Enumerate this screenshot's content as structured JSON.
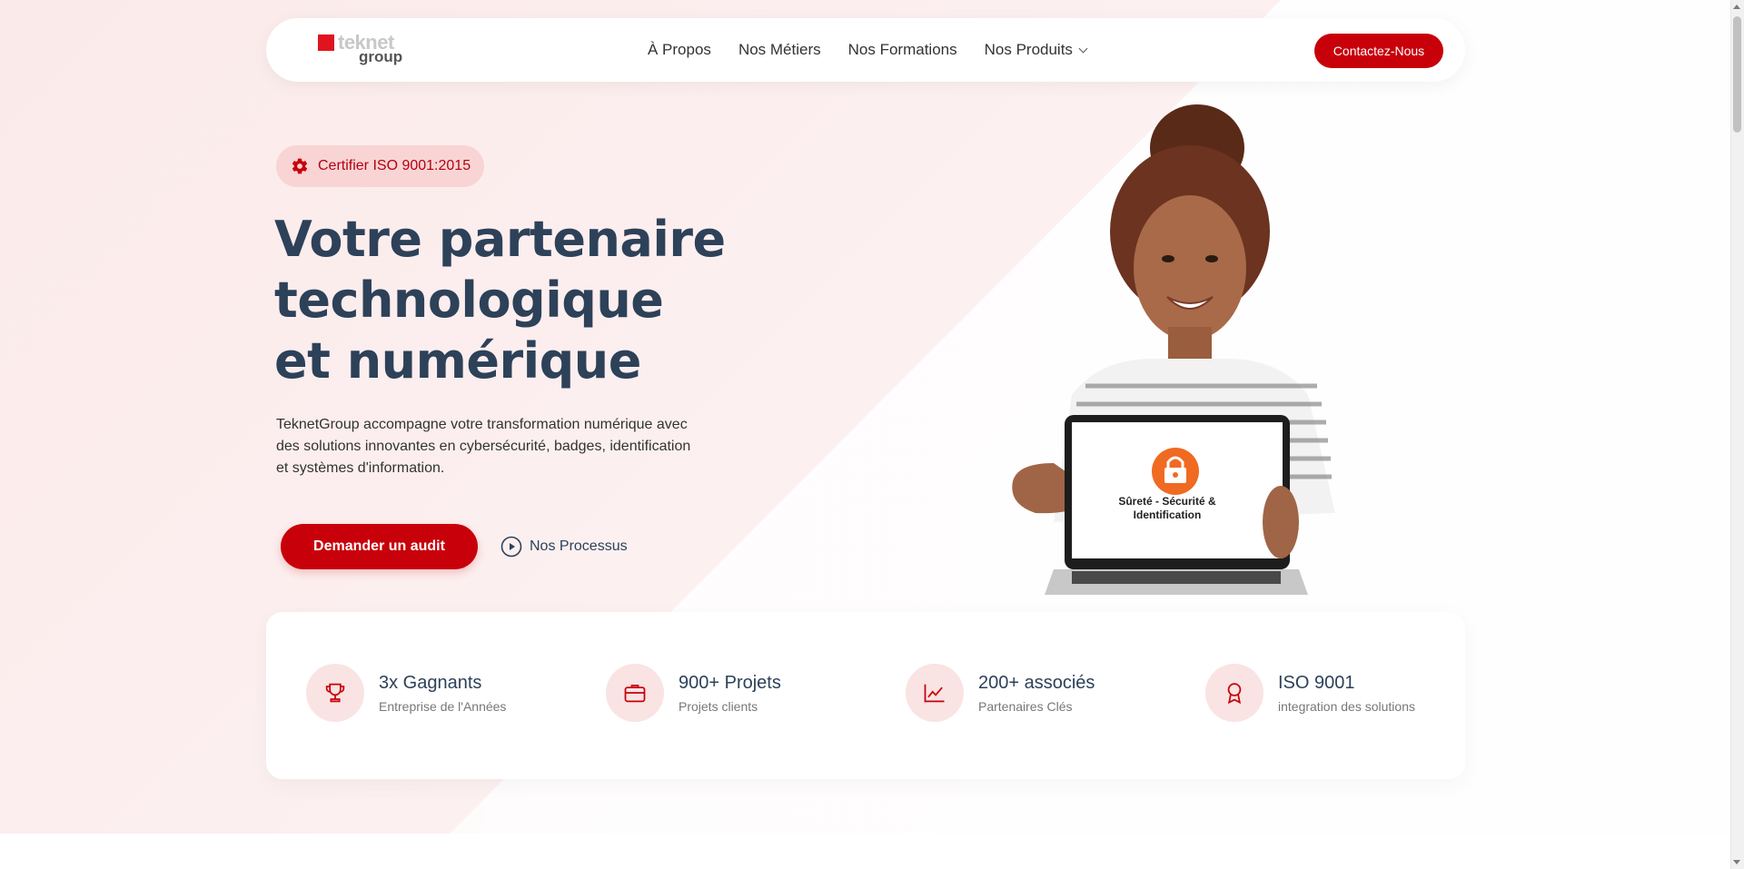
{
  "colors": {
    "accent": "#c8000a",
    "headline": "#2d4159",
    "badge_bg": "#f8d4d4",
    "icon_bg": "#f9e3e3"
  },
  "logo": {
    "mark": "teknet",
    "sub": "group"
  },
  "nav": {
    "items": [
      {
        "label": "À Propos"
      },
      {
        "label": "Nos Métiers"
      },
      {
        "label": "Nos Formations"
      },
      {
        "label": "Nos Produits",
        "icon": "chevron-down-icon"
      }
    ],
    "cta_label": "Contactez-Nous"
  },
  "hero": {
    "badge": {
      "icon": "gear-icon",
      "label": "Certifier ISO 9001:2015"
    },
    "headline": [
      "Votre partenaire",
      "technologique",
      "et numérique"
    ],
    "description": "TeknetGroup accompagne votre transformation numérique avec des solutions innovantes en cybersécurité, badges, identification et systèmes d'information.",
    "primary_button": "Demander un audit",
    "secondary_link": {
      "icon": "play-icon",
      "label": "Nos Processus"
    },
    "laptop_screen_text": "Sûreté - Sécurité & Identification"
  },
  "stats": [
    {
      "icon": "trophy-icon",
      "value": "3x Gagnants",
      "label": "Entreprise de l'Années"
    },
    {
      "icon": "briefcase-icon",
      "value": "900+ Projets",
      "label": "Projets clients"
    },
    {
      "icon": "chart-line-icon",
      "value": "200+ associés",
      "label": "Partenaires Clés"
    },
    {
      "icon": "award-icon",
      "value": "ISO 9001",
      "label": "integration des solutions"
    }
  ]
}
